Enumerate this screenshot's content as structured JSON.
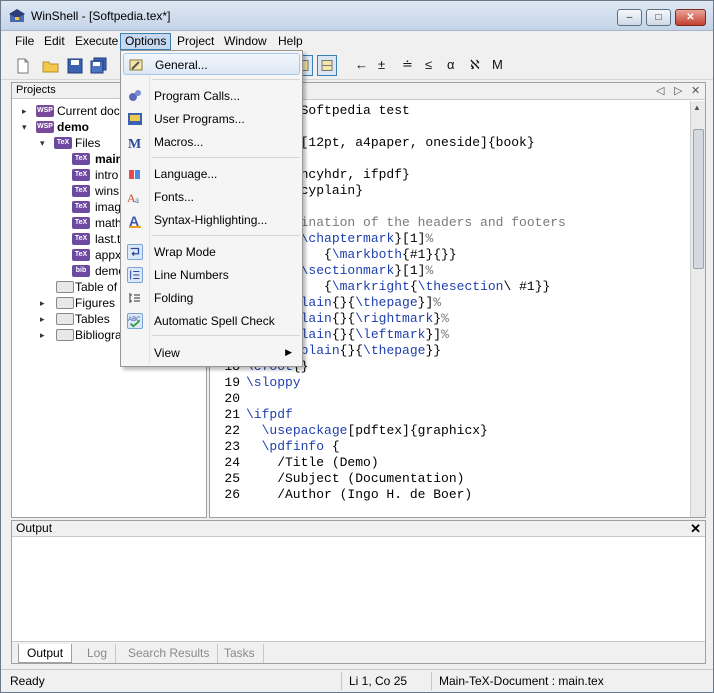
{
  "window": {
    "title": "WinShell - [Softpedia.tex*]",
    "controls": {
      "minimize": "–",
      "maximize": "□",
      "close": "✕"
    }
  },
  "menubar": {
    "items": [
      {
        "label": "File"
      },
      {
        "label": "Edit"
      },
      {
        "label": "Execute"
      },
      {
        "label": "Options"
      },
      {
        "label": "Project"
      },
      {
        "label": "Window"
      },
      {
        "label": "Help"
      }
    ]
  },
  "toolbar": {
    "symbols": [
      "←",
      "±",
      "≐",
      "≤",
      "α",
      "ℵ",
      "M"
    ]
  },
  "projects": {
    "title": "Projects",
    "tree": [
      {
        "label": "Current doc",
        "icon": "wsp-icon",
        "arrow": "▸"
      },
      {
        "label": "demo",
        "icon": "wsp-icon",
        "arrow": "▾",
        "bold": true
      },
      {
        "label": "Files",
        "icon": "tex-icon",
        "arrow": "▾"
      },
      {
        "label": "main",
        "icon": "tex-icon",
        "bold": true
      },
      {
        "label": "intro",
        "icon": "tex-icon"
      },
      {
        "label": "wins",
        "icon": "tex-icon"
      },
      {
        "label": "imag",
        "icon": "tex-icon"
      },
      {
        "label": "math",
        "icon": "tex-icon"
      },
      {
        "label": "last.t",
        "icon": "tex-icon"
      },
      {
        "label": "appx",
        "icon": "tex-icon"
      },
      {
        "label": "demo",
        "icon": "bib-icon"
      },
      {
        "label": "Table of",
        "icon": "document-icon"
      },
      {
        "label": "Figures",
        "icon": "document-icon",
        "arrow": "▸"
      },
      {
        "label": "Tables",
        "icon": "document-icon",
        "arrow": "▸"
      },
      {
        "label": "Bibliogra",
        "icon": "document-icon",
        "arrow": "▸"
      }
    ]
  },
  "editor": {
    "nav": {
      "prev": "◁",
      "next": "▷",
      "close": "✕"
    },
    "lines": [
      {
        "n": "",
        "parts": [
          {
            "t": "     a Softpedia test",
            "c": ""
          }
        ]
      },
      {
        "n": "",
        "parts": []
      },
      {
        "n": "",
        "parts": [
          {
            "t": "ntclass",
            "c": "cmd"
          },
          {
            "t": "[12pt, a4paper, oneside]{book}",
            "c": ""
          }
        ]
      },
      {
        "n": "",
        "parts": []
      },
      {
        "n": "",
        "parts": [
          {
            "t": "kage",
            "c": "cmd"
          },
          {
            "t": "{fancyhdr, ifpdf}",
            "c": ""
          }
        ]
      },
      {
        "n": "",
        "parts": [
          {
            "t": "yle",
            "c": "cmd"
          },
          {
            "t": "{fancyplain}",
            "c": ""
          }
        ]
      },
      {
        "n": "",
        "parts": []
      },
      {
        "n": "",
        "parts": [
          {
            "t": "  redefination of the headers and footers",
            "c": "cmt"
          }
        ]
      },
      {
        "n": "",
        "parts": [
          {
            "t": "ommand",
            "c": "cmd"
          },
          {
            "t": "{",
            "c": ""
          },
          {
            "t": "\\chaptermark",
            "c": "cmd"
          },
          {
            "t": "}[1]",
            "c": ""
          },
          {
            "t": "%",
            "c": "cmt"
          }
        ]
      },
      {
        "n": "",
        "parts": [
          {
            "t": "          {",
            "c": ""
          },
          {
            "t": "\\markboth",
            "c": "cmd"
          },
          {
            "t": "{#1}{}}",
            "c": ""
          }
        ]
      },
      {
        "n": "",
        "parts": [
          {
            "t": "ommand",
            "c": "cmd"
          },
          {
            "t": "{",
            "c": ""
          },
          {
            "t": "\\sectionmark",
            "c": "cmd"
          },
          {
            "t": "}[1]",
            "c": ""
          },
          {
            "t": "%",
            "c": "cmt"
          }
        ]
      },
      {
        "n": "",
        "parts": [
          {
            "t": "          {",
            "c": ""
          },
          {
            "t": "\\markright",
            "c": "cmd"
          },
          {
            "t": "{",
            "c": ""
          },
          {
            "t": "\\thesection",
            "c": "cmd"
          },
          {
            "t": "\\ #1}}",
            "c": ""
          }
        ]
      },
      {
        "n": "",
        "parts": [
          {
            "t": "\\fancyplain",
            "c": "cmd"
          },
          {
            "t": "{}{",
            "c": ""
          },
          {
            "t": "\\thepage",
            "c": "cmd"
          },
          {
            "t": "}]",
            "c": ""
          },
          {
            "t": "%",
            "c": "cmt"
          }
        ]
      },
      {
        "n": "",
        "parts": [
          {
            "t": "\\fancyplain",
            "c": "cmd"
          },
          {
            "t": "{}{",
            "c": ""
          },
          {
            "t": "\\rightmark",
            "c": "cmd"
          },
          {
            "t": "}",
            "c": ""
          },
          {
            "t": "%",
            "c": "cmt"
          }
        ]
      },
      {
        "n": "",
        "parts": [
          {
            "t": "\\fancyplain",
            "c": "cmd"
          },
          {
            "t": "{}{",
            "c": ""
          },
          {
            "t": "\\leftmark",
            "c": "cmd"
          },
          {
            "t": "}]",
            "c": ""
          },
          {
            "t": "%",
            "c": "cmt"
          }
        ]
      },
      {
        "n": "",
        "parts": [
          {
            "t": "{",
            "c": ""
          },
          {
            "t": "\\fancyplain",
            "c": "cmd"
          },
          {
            "t": "{}{",
            "c": ""
          },
          {
            "t": "\\thepage",
            "c": "cmd"
          },
          {
            "t": "}}",
            "c": ""
          }
        ]
      },
      {
        "n": "18",
        "parts": [
          {
            "t": "\\cfoot",
            "c": "cmd"
          },
          {
            "t": "{}",
            "c": ""
          }
        ]
      },
      {
        "n": "19",
        "parts": [
          {
            "t": "\\sloppy",
            "c": "cmd"
          }
        ]
      },
      {
        "n": "20",
        "parts": []
      },
      {
        "n": "21",
        "parts": [
          {
            "t": "\\ifpdf",
            "c": "cmd"
          }
        ]
      },
      {
        "n": "22",
        "parts": [
          {
            "t": "  ",
            "c": ""
          },
          {
            "t": "\\usepackage",
            "c": "cmd"
          },
          {
            "t": "[pdftex]{graphicx}",
            "c": ""
          }
        ]
      },
      {
        "n": "23",
        "parts": [
          {
            "t": "  ",
            "c": ""
          },
          {
            "t": "\\pdfinfo",
            "c": "cmd"
          },
          {
            "t": " {",
            "c": ""
          }
        ]
      },
      {
        "n": "24",
        "parts": [
          {
            "t": "    /Title (Demo)",
            "c": ""
          }
        ]
      },
      {
        "n": "25",
        "parts": [
          {
            "t": "    /Subject (Documentation)",
            "c": ""
          }
        ]
      },
      {
        "n": "26",
        "parts": [
          {
            "t": "    /Author (Ingo H. de Boer)",
            "c": ""
          }
        ]
      }
    ]
  },
  "output": {
    "title": "Output",
    "close": "✕",
    "tabs": [
      {
        "label": "Output",
        "active": true
      },
      {
        "label": "Log"
      },
      {
        "label": "Search Results"
      },
      {
        "label": "Tasks"
      }
    ]
  },
  "status": {
    "ready": "Ready",
    "position": "Li 1, Co 25",
    "document": "Main-TeX-Document : main.tex"
  },
  "options_menu": {
    "items": [
      {
        "label": "General...",
        "icon": "wrench-icon",
        "highlight": true
      },
      {
        "label": "Program Calls...",
        "icon": "gears-icon"
      },
      {
        "label": "User Programs...",
        "icon": "programs-icon"
      },
      {
        "label": "Macros...",
        "icon": "macro-icon"
      },
      {
        "label": "Language...",
        "icon": "language-icon"
      },
      {
        "label": "Fonts...",
        "icon": "fonts-icon"
      },
      {
        "label": "Syntax-Highlighting...",
        "icon": "syntax-icon"
      },
      {
        "label": "Wrap Mode",
        "icon": "wrap-icon",
        "checked": true
      },
      {
        "label": "Line Numbers",
        "icon": "line-numbers-icon",
        "checked": true
      },
      {
        "label": "Folding",
        "icon": "folding-icon"
      },
      {
        "label": "Automatic Spell Check",
        "icon": "spellcheck-icon",
        "checked": true
      },
      {
        "label": "View",
        "icon": "",
        "submenu": true
      }
    ],
    "submenu_arrow": "▶"
  }
}
